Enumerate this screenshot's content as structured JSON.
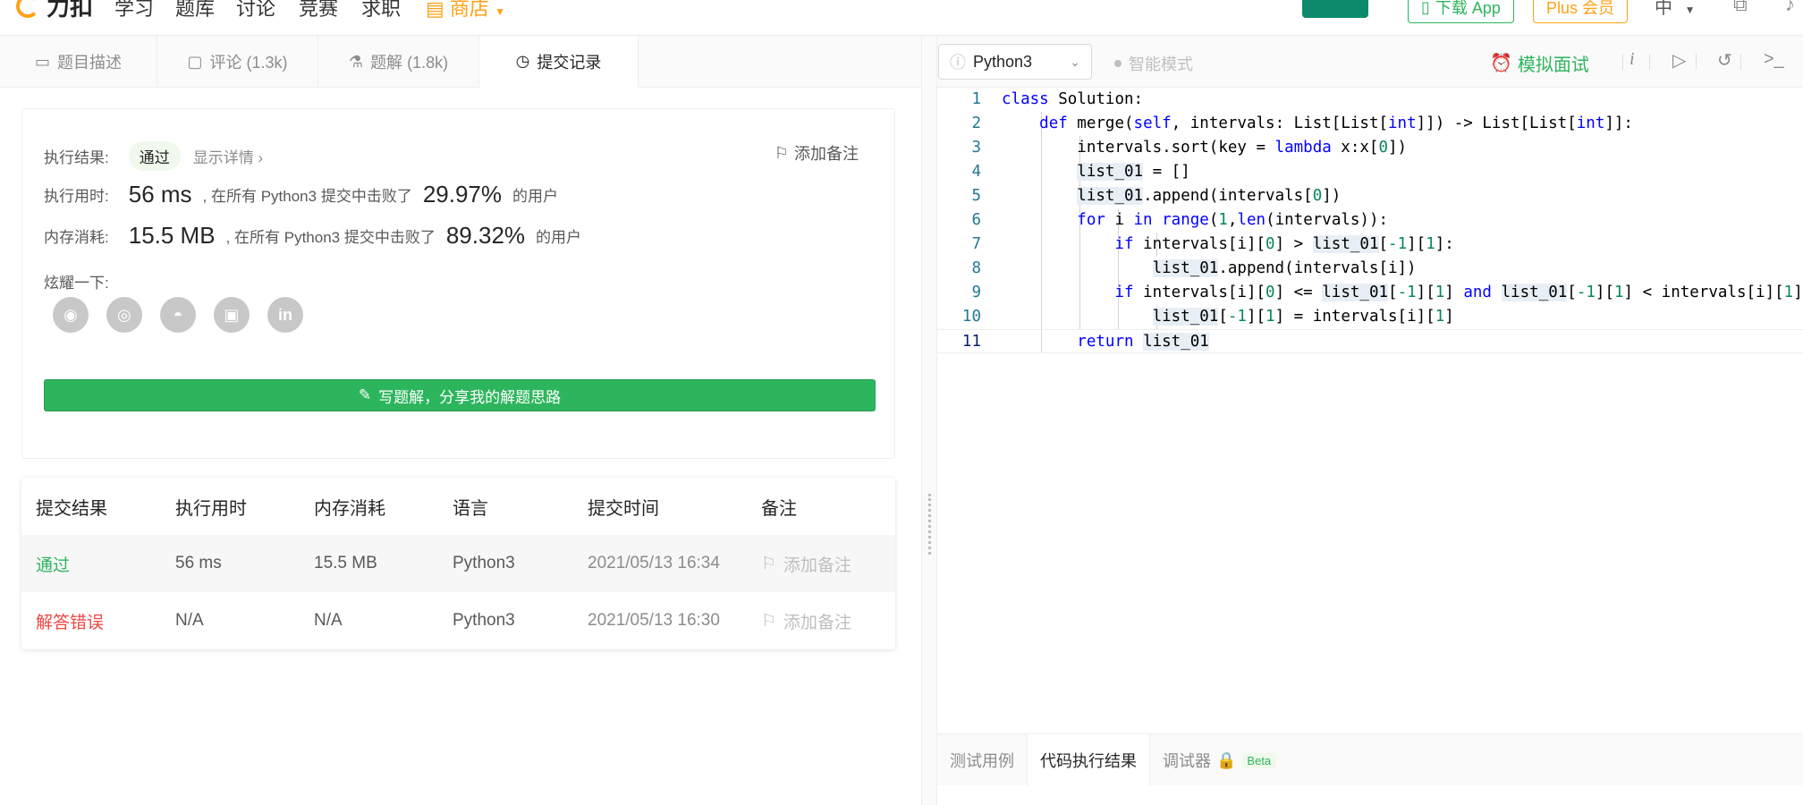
{
  "nav": {
    "logo": "力扣",
    "items": [
      "学习",
      "题库",
      "讨论",
      "竞赛",
      "求职"
    ],
    "shop": "商店",
    "download_app": "下载 App",
    "plus": "Plus 会员",
    "lang": "中"
  },
  "left_tabs": [
    {
      "label": "题目描述",
      "icon": "description-icon"
    },
    {
      "label": "评论 (1.3k)",
      "icon": "comment-icon"
    },
    {
      "label": "题解 (1.8k)",
      "icon": "flask-icon"
    },
    {
      "label": "提交记录",
      "icon": "clock-icon"
    }
  ],
  "result": {
    "result_label": "执行结果:",
    "status": "通过",
    "show_detail": "显示详情",
    "add_note": "添加备注",
    "time_label": "执行用时:",
    "time_value": "56 ms",
    "beat_prefix": ", 在所有 Python3 提交中击败了",
    "time_percent": "29.97%",
    "users": "的用户",
    "mem_label": "内存消耗:",
    "mem_value": "15.5 MB",
    "mem_percent": "89.32%",
    "share_label": "炫耀一下:",
    "share_icons": [
      "wechat-icon",
      "weibo-icon",
      "qq-icon",
      "douban-icon",
      "linkedin-icon"
    ],
    "write_solution": "写题解，分享我的解题思路"
  },
  "submissions": {
    "headers": [
      "提交结果",
      "执行用时",
      "内存消耗",
      "语言",
      "提交时间",
      "备注"
    ],
    "rows": [
      {
        "status": "通过",
        "time": "56 ms",
        "memory": "15.5 MB",
        "lang": "Python3",
        "date": "2021/05/13 16:34",
        "note": "添加备注"
      },
      {
        "status": "解答错误",
        "time": "N/A",
        "memory": "N/A",
        "lang": "Python3",
        "date": "2021/05/13 16:30",
        "note": "添加备注"
      }
    ]
  },
  "editor": {
    "language": "Python3",
    "smart_mode": "智能模式",
    "mock_interview": "模拟面试",
    "code_lines": [
      "1",
      "2",
      "3",
      "4",
      "5",
      "6",
      "7",
      "8",
      "9",
      "10",
      "11"
    ]
  },
  "bottom_tabs": {
    "test_case": "测试用例",
    "exec_result": "代码执行结果",
    "debugger": "调试器",
    "beta": "Beta"
  },
  "colors": {
    "accent_green": "#2db55d",
    "error_red": "#ef4743",
    "shop_orange": "#ffa116",
    "keyword_blue": "#0000ff",
    "number_green": "#098658"
  }
}
